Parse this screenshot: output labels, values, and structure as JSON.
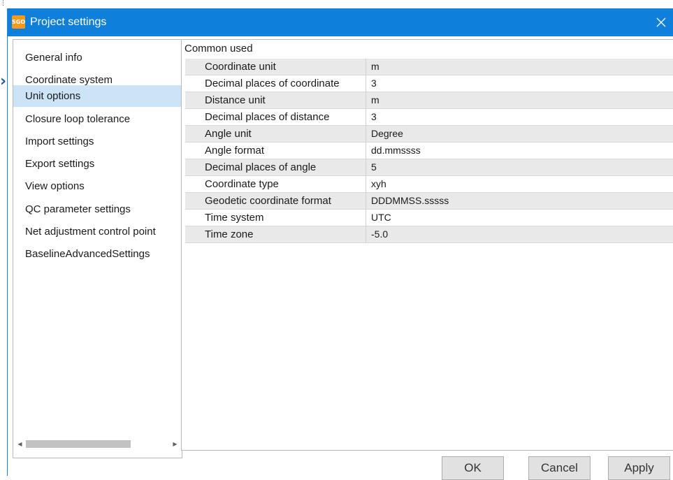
{
  "dialog": {
    "app_logo_text": "SGO",
    "title": "Project settings"
  },
  "nav": {
    "items": [
      {
        "label": "General info"
      },
      {
        "label": "Coordinate system"
      },
      {
        "label": "Unit options",
        "selected": true
      },
      {
        "label": "Closure loop tolerance"
      },
      {
        "label": "Import settings"
      },
      {
        "label": "Export settings"
      },
      {
        "label": "View options"
      },
      {
        "label": "QC parameter settings"
      },
      {
        "label": "Net adjustment control point"
      },
      {
        "label": "BaselineAdvancedSettings"
      }
    ]
  },
  "grid": {
    "group": "Common used",
    "rows": [
      {
        "name": "Coordinate unit",
        "value": "m"
      },
      {
        "name": "Decimal places of coordinate",
        "value": "3"
      },
      {
        "name": "Distance unit",
        "value": "m"
      },
      {
        "name": "Decimal places of distance",
        "value": "3"
      },
      {
        "name": "Angle unit",
        "value": "Degree"
      },
      {
        "name": "Angle format",
        "value": "dd.mmssss"
      },
      {
        "name": "Decimal places of angle",
        "value": "5"
      },
      {
        "name": "Coordinate type",
        "value": "xyh"
      },
      {
        "name": "Geodetic coordinate format",
        "value": "DDDMMSS.sssss"
      },
      {
        "name": "Time system",
        "value": "UTC"
      },
      {
        "name": "Time zone",
        "value": "-5.0"
      }
    ]
  },
  "buttons": {
    "ok": "OK",
    "cancel": "Cancel",
    "apply": "Apply"
  },
  "colors": {
    "titlebar": "#0f7fdc",
    "selected_nav": "#cce4f7",
    "alt_row": "#e9e9e9",
    "logo": "#f59a1b"
  },
  "icons": {
    "close": "close-icon",
    "scroll_left": "scroll-left-icon",
    "scroll_right": "scroll-right-icon"
  }
}
